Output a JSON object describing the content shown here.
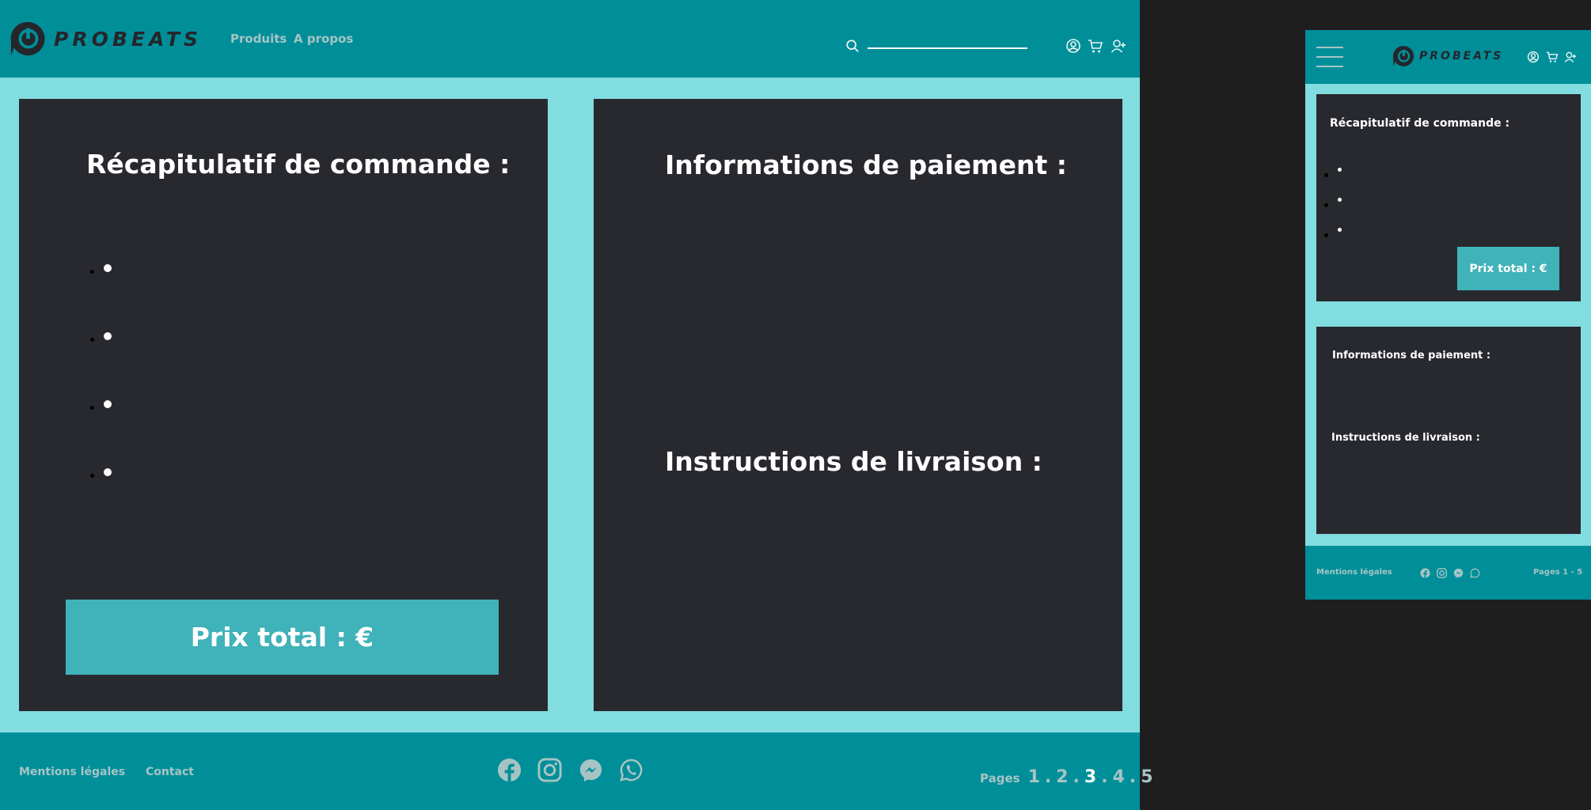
{
  "brand": {
    "name": "PROBEATS"
  },
  "colors": {
    "header": "#008f99",
    "page_bg": "#82dde0",
    "panel": "#28292e",
    "accent_button": "#40b2b9",
    "muted_text": "#a7c4c5",
    "outside": "#1e1e1f"
  },
  "nav": {
    "products": "Produits",
    "about": "A propos"
  },
  "search": {
    "placeholder": ""
  },
  "header_icons": [
    "user-circle-icon",
    "cart-icon",
    "user-add-icon"
  ],
  "summary": {
    "title": "Récapitulatif de commande :",
    "items": [
      "",
      "",
      "",
      ""
    ],
    "total_label": "Prix total : €"
  },
  "payment": {
    "title": "Informations de paiement :"
  },
  "delivery": {
    "title": "Instructions de livraison :"
  },
  "footer": {
    "legal": "Mentions légales",
    "contact": "Contact",
    "social_icons": [
      "facebook-icon",
      "instagram-icon",
      "messenger-icon",
      "whatsapp-icon"
    ],
    "pages_label": "Pages",
    "pages": [
      "1",
      "2",
      "3",
      "4",
      "5"
    ],
    "active_page": "3"
  },
  "mobile": {
    "summary_items": [
      "",
      "",
      ""
    ],
    "pages_text": "Pages 1 - 5"
  }
}
